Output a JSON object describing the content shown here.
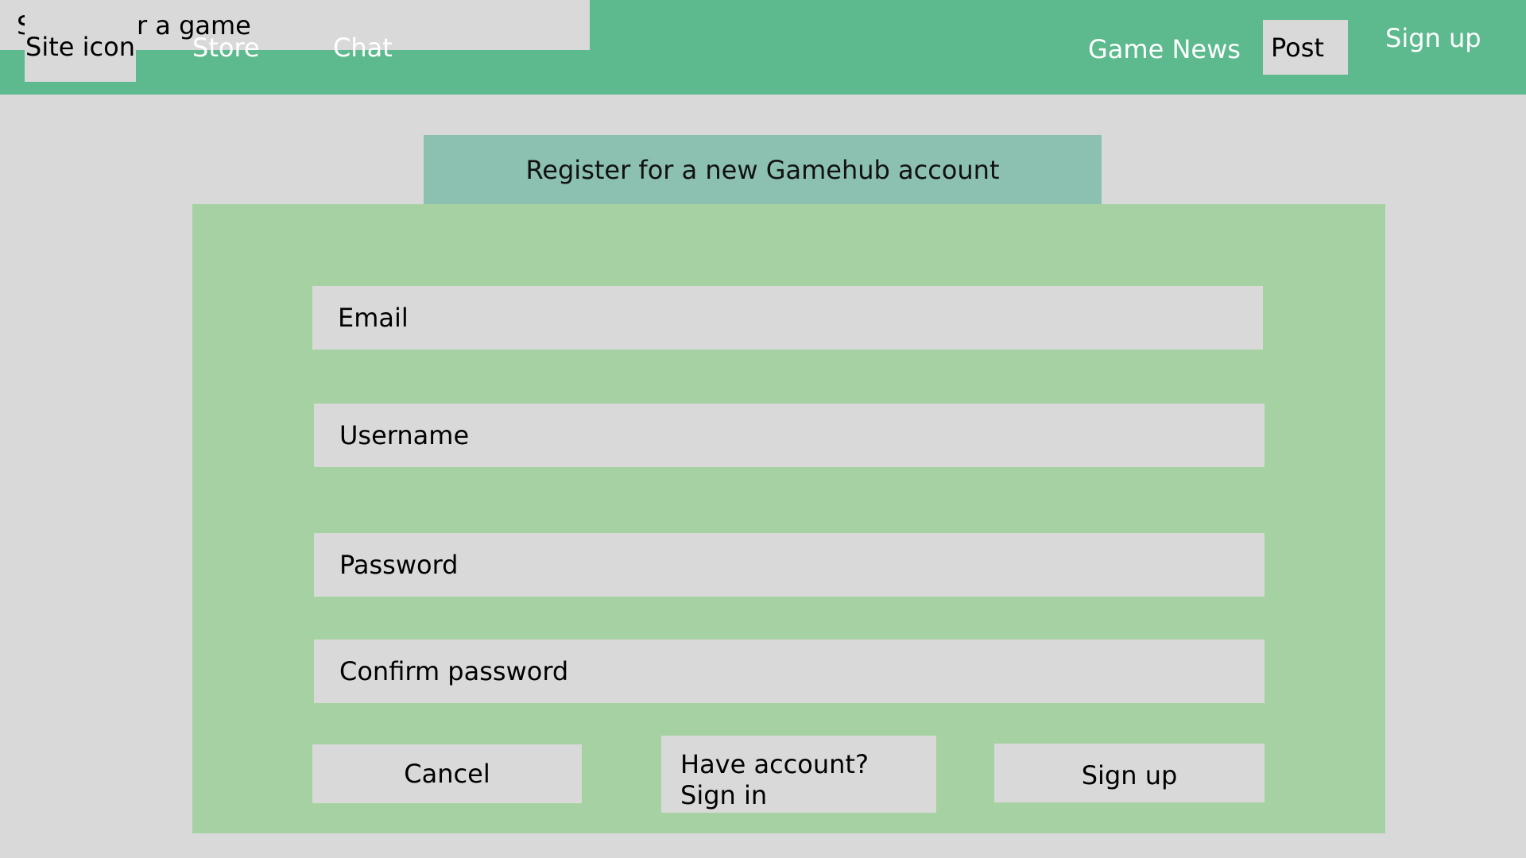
{
  "navbar": {
    "site_icon": "Site icon",
    "store": "Store",
    "chat": "Chat",
    "search_placeholder": "Search for a game",
    "game_news": "Game News",
    "post": "Post",
    "sign_up": "Sign up"
  },
  "form": {
    "title": "Register for a new Gamehub account",
    "email_placeholder": "Email",
    "username_placeholder": "Username",
    "password_placeholder": "Password",
    "confirm_password_placeholder": "Confirm password",
    "cancel_label": "Cancel",
    "sign_in_label": "Have account? Sign in",
    "sign_up_label": "Sign up"
  },
  "colors": {
    "navbar": "#5dba8e",
    "page_background": "#d9d9d9",
    "form_header": "#8cc0b0",
    "form_panel": "#a6d2a3"
  }
}
